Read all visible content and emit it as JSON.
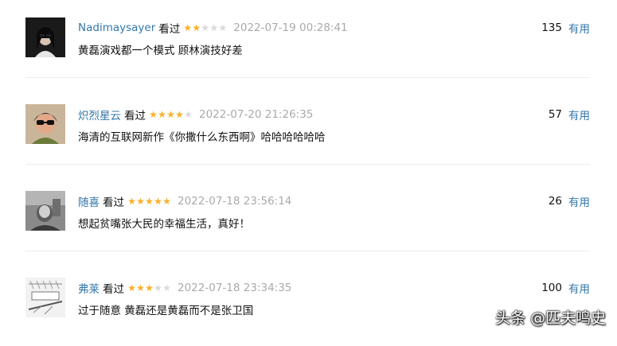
{
  "colors": {
    "author": "#3377aa",
    "star_on": "#f9b127",
    "star_off": "#d9d9d9",
    "date": "#aaaaaa"
  },
  "comments": [
    {
      "author": "Nadimaysayer",
      "status": "看过",
      "rating": 2,
      "date": "2022-07-19 00:28:41",
      "votes": "135",
      "useful": "有用",
      "text": "黄磊演戏都一个模式 顾林演技好差"
    },
    {
      "author": "炽烈星云",
      "status": "看过",
      "rating": 4,
      "date": "2022-07-20 21:26:35",
      "votes": "57",
      "useful": "有用",
      "text": "海清的互联网新作《你撒什么东西啊》哈哈哈哈哈哈"
    },
    {
      "author": "随喜",
      "status": "看过",
      "rating": 5,
      "date": "2022-07-18 23:56:14",
      "votes": "26",
      "useful": "有用",
      "text": "想起贫嘴张大民的幸福生活，真好！"
    },
    {
      "author": "弗莱",
      "status": "看过",
      "rating": 3,
      "date": "2022-07-18 23:34:35",
      "votes": "100",
      "useful": "有用",
      "text": "过于随意 黄磊还是黄磊而不是张卫国"
    }
  ],
  "watermark": "头条 @匹夫鸣史"
}
